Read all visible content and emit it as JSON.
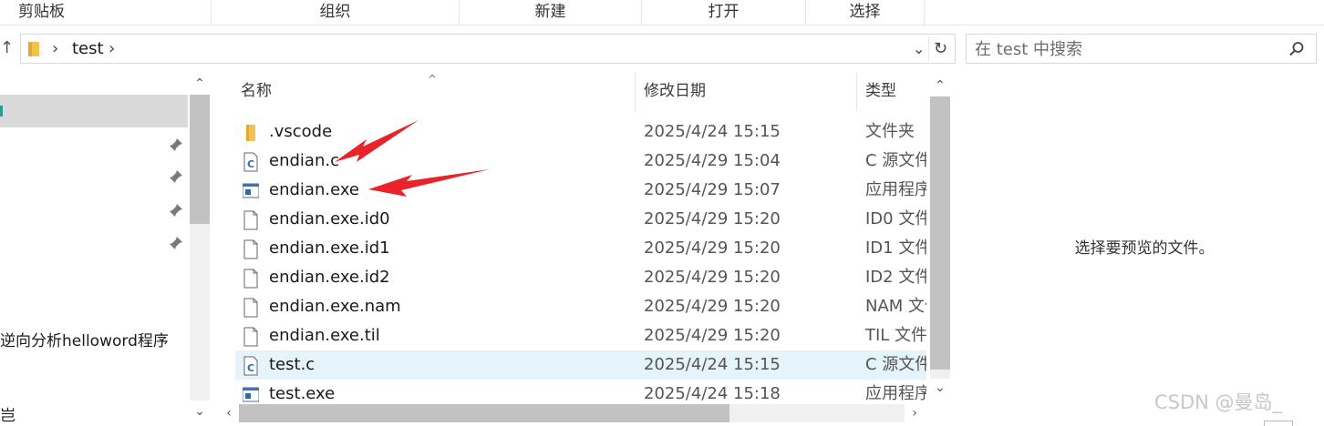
{
  "ribbon": {
    "groups": [
      "剪贴板",
      "组织",
      "新建",
      "打开",
      "选择"
    ]
  },
  "address": {
    "crumbs": [
      "test"
    ],
    "search_placeholder": "在 test 中搜索"
  },
  "nav": {
    "partial_items": [
      "逆向分析helloword程序",
      "岂"
    ]
  },
  "files": {
    "columns": [
      "名称",
      "修改日期",
      "类型"
    ],
    "rows": [
      {
        "name": ".vscode",
        "date": "2025/4/24 15:15",
        "type": "文件夹",
        "icon": "folder-icon"
      },
      {
        "name": "endian.c",
        "date": "2025/4/29 15:04",
        "type": "C 源文件",
        "icon": "c-source-file-icon"
      },
      {
        "name": "endian.exe",
        "date": "2025/4/29 15:07",
        "type": "应用程序",
        "icon": "application-icon"
      },
      {
        "name": "endian.exe.id0",
        "date": "2025/4/29 15:20",
        "type": "ID0 文件",
        "icon": "file-icon"
      },
      {
        "name": "endian.exe.id1",
        "date": "2025/4/29 15:20",
        "type": "ID1 文件",
        "icon": "file-icon"
      },
      {
        "name": "endian.exe.id2",
        "date": "2025/4/29 15:20",
        "type": "ID2 文件",
        "icon": "file-icon"
      },
      {
        "name": "endian.exe.nam",
        "date": "2025/4/29 15:20",
        "type": "NAM 文件",
        "icon": "file-icon"
      },
      {
        "name": "endian.exe.til",
        "date": "2025/4/29 15:20",
        "type": "TIL 文件",
        "icon": "file-icon"
      },
      {
        "name": "test.c",
        "date": "2025/4/24 15:15",
        "type": "C 源文件",
        "icon": "c-source-file-icon"
      },
      {
        "name": "test.exe",
        "date": "2025/4/24 15:18",
        "type": "应用程序",
        "icon": "application-icon"
      }
    ]
  },
  "preview": {
    "message": "选择要预览的文件。"
  },
  "watermark": "CSDN @曼岛_",
  "colors": {
    "selected_row": "#e5f3fb",
    "annotation_arrow": "#e8232a",
    "folder": "#f2c14e",
    "c_icon": "#2b6cb0"
  }
}
